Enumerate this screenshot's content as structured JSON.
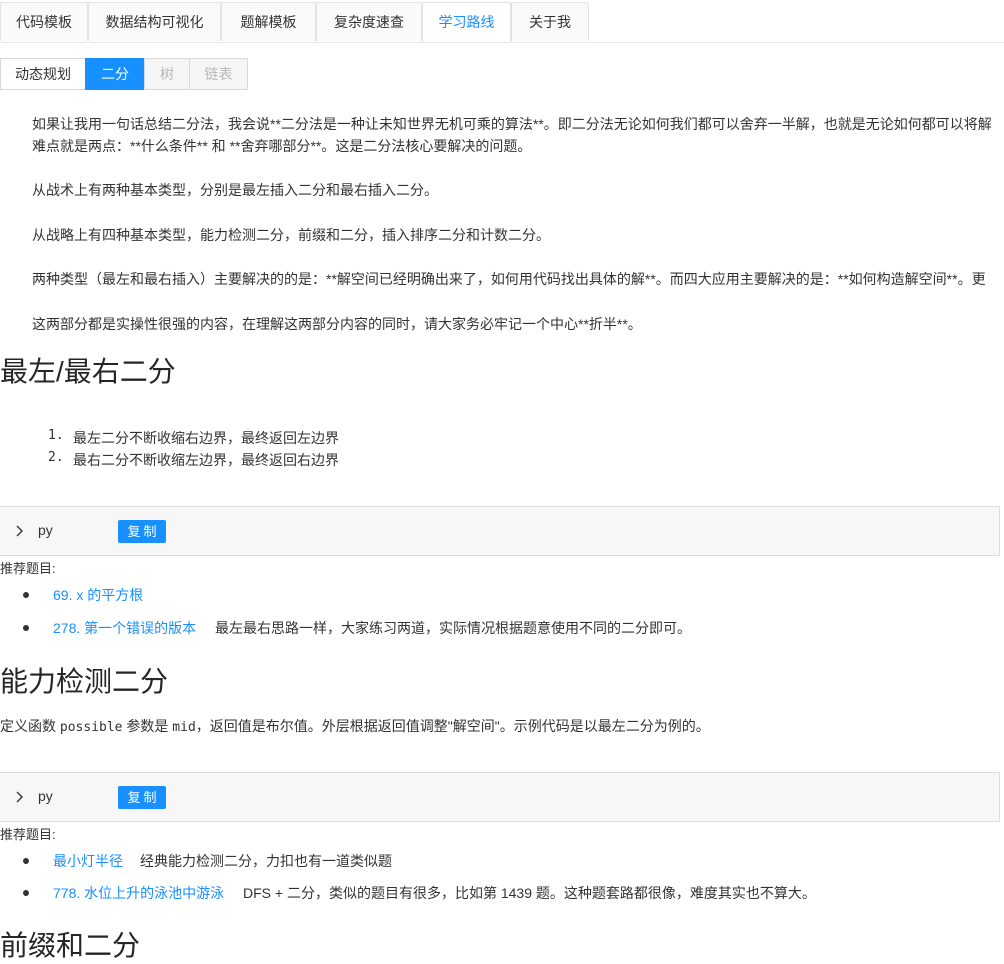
{
  "tabs": [
    "代码模板",
    "数据结构可视化",
    "题解模板",
    "复杂度速查",
    "学习路线",
    "关于我"
  ],
  "subtabs": [
    "动态规划",
    "二分",
    "树",
    "链表"
  ],
  "intro": {
    "p1_line1": "如果让我用一句话总结二分法，我会说**二分法是一种让未知世界无机可乘的算法**。即二分法无论如何我们都可以舍弃一半解，也就是无论如何都可以将解",
    "p1_line2": "难点就是两点：**什么条件** 和 **舍弃哪部分**。这是二分法核心要解决的问题。",
    "p2": "从战术上有两种基本类型，分别是最左插入二分和最右插入二分。",
    "p3": "从战略上有四种基本类型，能力检测二分，前缀和二分，插入排序二分和计数二分。",
    "p4": "两种类型（最左和最右插入）主要解决的的是：**解空间已经明确出来了，如何用代码找出具体的解**。而四大应用主要解决的是：**如何构造解空间**。更",
    "p5": "这两部分都是实操性很强的内容，在理解这两部分内容的同时，请大家务必牢记一个中心**折半**。"
  },
  "section1": {
    "title": "最左/最右二分",
    "ol": [
      {
        "num": "1.",
        "text": "最左二分不断收缩右边界，最终返回左边界"
      },
      {
        "num": "2.",
        "text": "最右二分不断收缩左边界，最终返回右边界"
      }
    ],
    "code": {
      "lang": "py",
      "copy": "复制"
    },
    "rec_label": "推荐题目:",
    "problems": [
      {
        "link": "69. x 的平方根",
        "note": ""
      },
      {
        "link": "278. 第一个错误的版本",
        "note": "最左最右思路一样，大家练习两道，实际情况根据题意使用不同的二分即可。"
      }
    ]
  },
  "section2": {
    "title": "能力检测二分",
    "desc_a": "定义函数 ",
    "desc_code1": "possible",
    "desc_b": " 参数是 ",
    "desc_code2": "mid",
    "desc_c": "，返回值是布尔值。外层根据返回值调整\"解空间\"。示例代码是以最左二分为例的。",
    "code": {
      "lang": "py",
      "copy": "复制"
    },
    "rec_label": "推荐题目:",
    "problems": [
      {
        "link": "最小灯半径",
        "note": "经典能力检测二分，力扣也有一道类似题"
      },
      {
        "link": "778. 水位上升的泳池中游泳",
        "note": "DFS + 二分，类似的题目有很多，比如第 1439 题。这种题套路都很像，难度其实也不算大。"
      }
    ]
  },
  "section3": {
    "title": "前缀和二分"
  },
  "colors": {
    "accent": "#1890ff",
    "text": "#333333",
    "border": "#d9d9d9"
  },
  "icons": {
    "code_toggle": "chevron-right-icon",
    "list_bullet": "bullet-icon"
  }
}
